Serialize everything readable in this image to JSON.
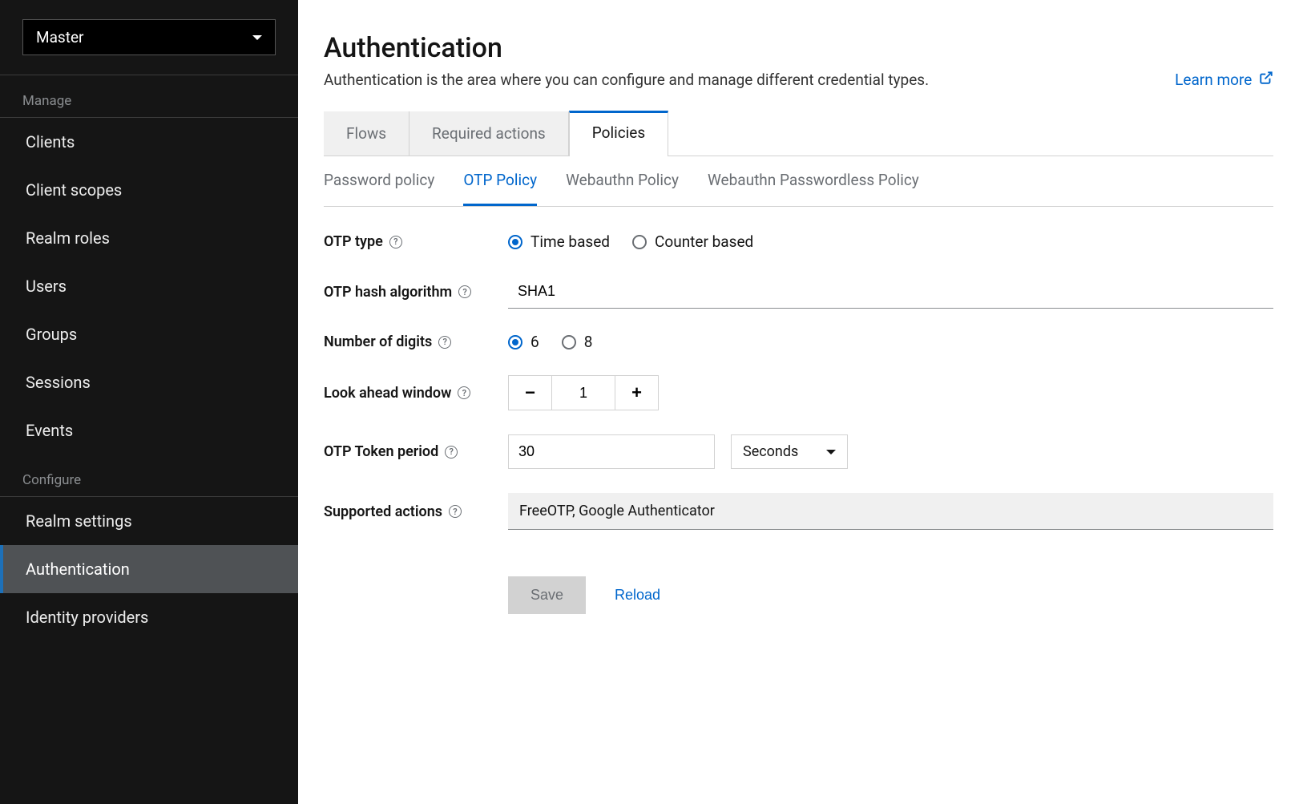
{
  "sidebar": {
    "realm": "Master",
    "sections": [
      {
        "title": "Manage",
        "items": [
          {
            "label": "Clients",
            "active": false
          },
          {
            "label": "Client scopes",
            "active": false
          },
          {
            "label": "Realm roles",
            "active": false
          },
          {
            "label": "Users",
            "active": false
          },
          {
            "label": "Groups",
            "active": false
          },
          {
            "label": "Sessions",
            "active": false
          },
          {
            "label": "Events",
            "active": false
          }
        ]
      },
      {
        "title": "Configure",
        "items": [
          {
            "label": "Realm settings",
            "active": false
          },
          {
            "label": "Authentication",
            "active": true
          },
          {
            "label": "Identity providers",
            "active": false
          }
        ]
      }
    ]
  },
  "header": {
    "title": "Authentication",
    "description": "Authentication is the area where you can configure and manage different credential types.",
    "learn_more": "Learn more"
  },
  "tabs_primary": [
    {
      "label": "Flows",
      "active": false
    },
    {
      "label": "Required actions",
      "active": false
    },
    {
      "label": "Policies",
      "active": true
    }
  ],
  "tabs_secondary": [
    {
      "label": "Password policy",
      "active": false
    },
    {
      "label": "OTP Policy",
      "active": true
    },
    {
      "label": "Webauthn Policy",
      "active": false
    },
    {
      "label": "Webauthn Passwordless Policy",
      "active": false
    }
  ],
  "form": {
    "otp_type": {
      "label": "OTP type",
      "options": [
        "Time based",
        "Counter based"
      ],
      "selected": "Time based"
    },
    "hash_algo": {
      "label": "OTP hash algorithm",
      "value": "SHA1"
    },
    "digits": {
      "label": "Number of digits",
      "options": [
        "6",
        "8"
      ],
      "selected": "6"
    },
    "look_ahead": {
      "label": "Look ahead window",
      "value": "1"
    },
    "token_period": {
      "label": "OTP Token period",
      "value": "30",
      "unit": "Seconds"
    },
    "supported_actions": {
      "label": "Supported actions",
      "value": "FreeOTP, Google Authenticator"
    }
  },
  "actions": {
    "save": "Save",
    "reload": "Reload"
  }
}
